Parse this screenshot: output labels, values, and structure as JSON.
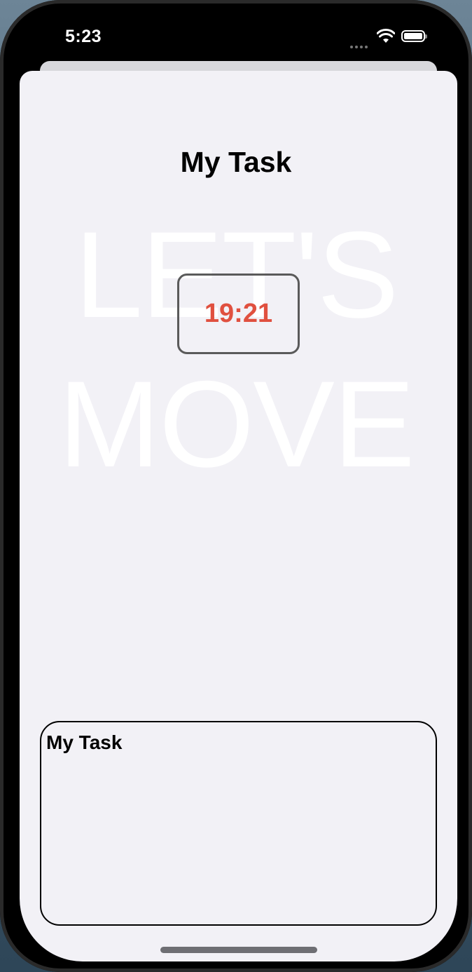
{
  "status_bar": {
    "time": "5:23",
    "icons": [
      "cellular-signal-icon",
      "wifi-icon",
      "battery-icon"
    ]
  },
  "screen": {
    "title": "My Task",
    "background_text": [
      "LET'S",
      "MOVE"
    ],
    "timer": "19:21",
    "task_text": "My Task"
  },
  "colors": {
    "timer_text": "#e0503f",
    "sheet_background": "#f2f1f6",
    "background_text": "#ffffff"
  }
}
